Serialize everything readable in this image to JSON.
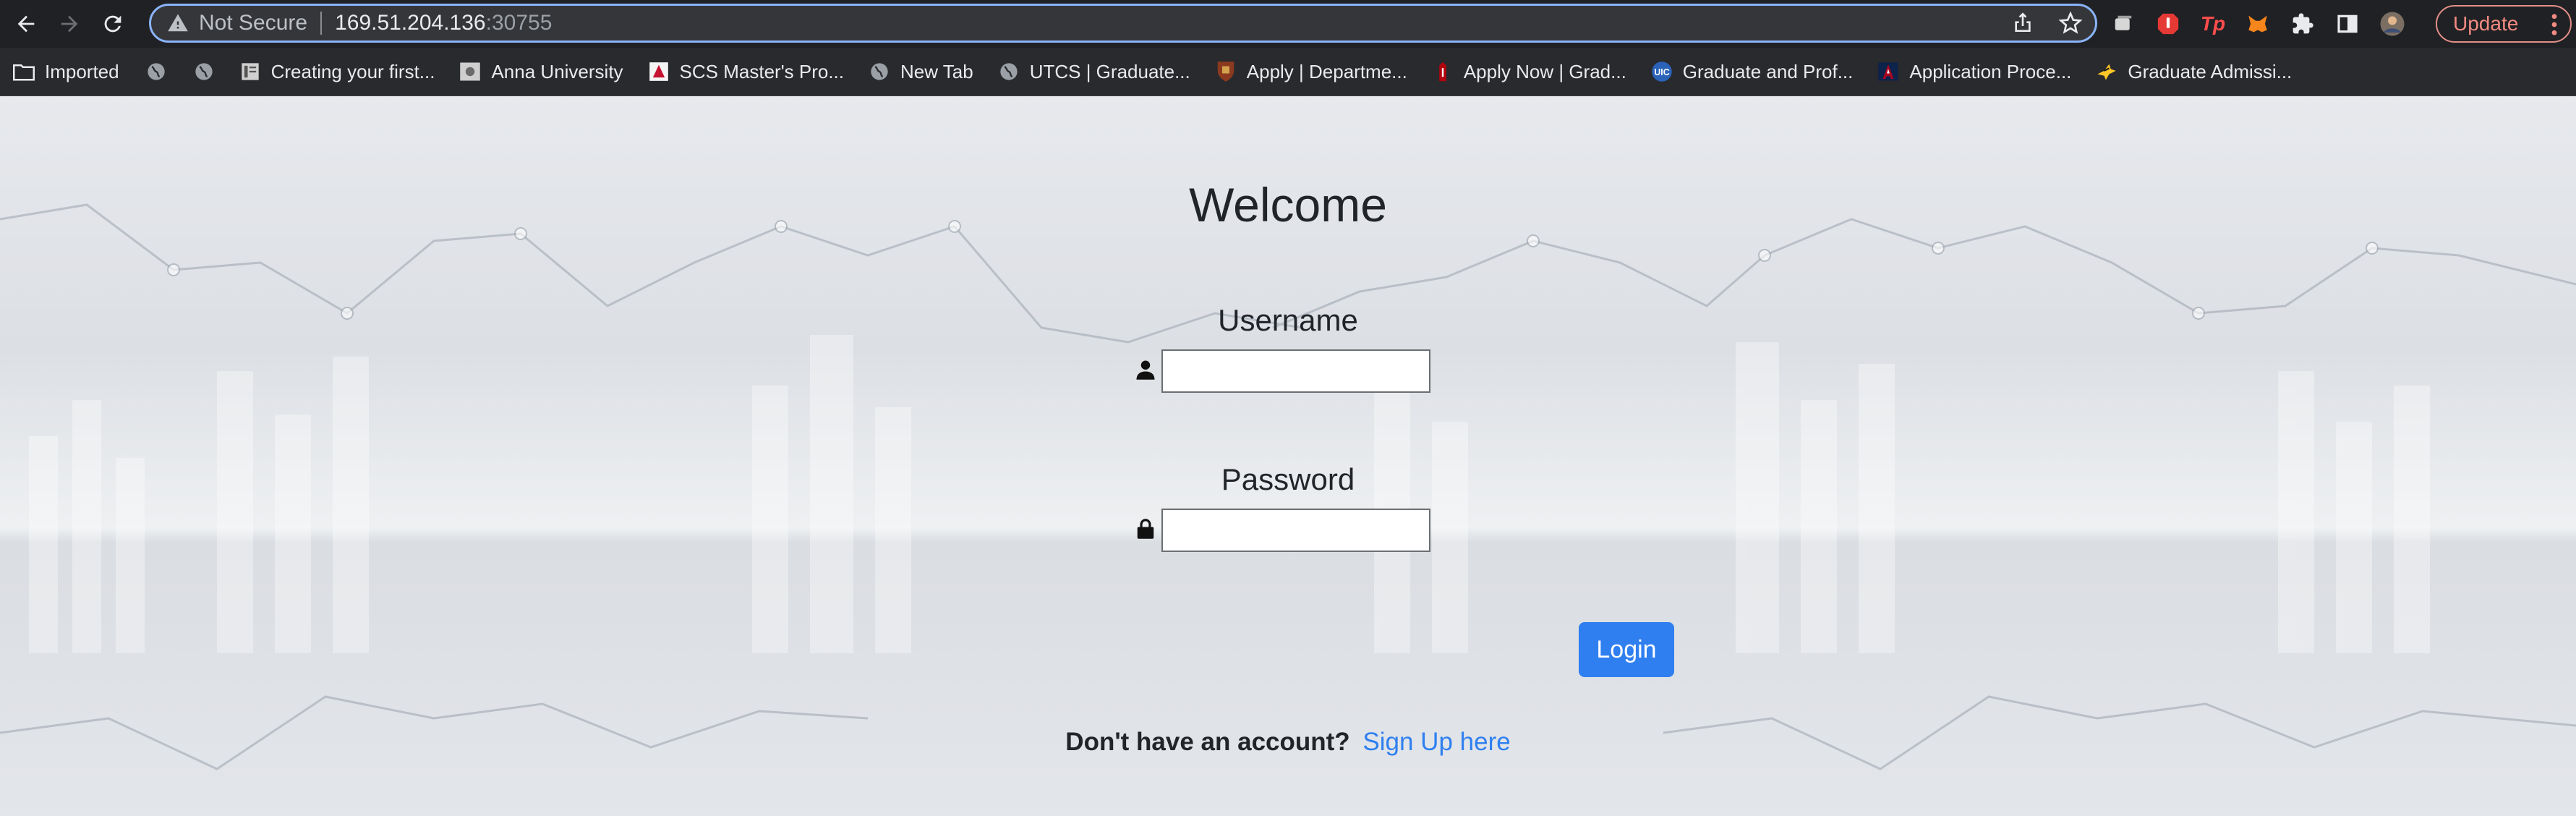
{
  "browser": {
    "address": {
      "security_label": "Not Secure",
      "host": "169.51.204.136",
      "port": ":30755"
    },
    "update_label": "Update",
    "bookmarks": [
      {
        "label": "Imported",
        "icon": "folder-icon"
      },
      {
        "label": "",
        "icon": "globe-icon"
      },
      {
        "label": "",
        "icon": "globe-icon"
      },
      {
        "label": "Creating your first...",
        "icon": "doc-icon"
      },
      {
        "label": "Anna University",
        "icon": "site-icon"
      },
      {
        "label": "SCS Master's Pro...",
        "icon": "cmu-icon"
      },
      {
        "label": "New Tab",
        "icon": "globe-icon"
      },
      {
        "label": "UTCS | Graduate...",
        "icon": "globe-icon"
      },
      {
        "label": "Apply | Departme...",
        "icon": "crest-icon"
      },
      {
        "label": "Apply Now | Grad...",
        "icon": "stanford-icon"
      },
      {
        "label": "Graduate and Prof...",
        "icon": "uic-icon"
      },
      {
        "label": "Application Proce...",
        "icon": "arizona-icon"
      },
      {
        "label": "Graduate Admissi...",
        "icon": "eagle-icon"
      }
    ]
  },
  "page": {
    "title": "Welcome",
    "username_label": "Username",
    "username_value": "",
    "password_label": "Password",
    "password_value": "",
    "login_label": "Login",
    "signup_prompt": "Don't have an account?",
    "signup_link": "Sign Up here"
  },
  "colors": {
    "primary": "#2f7ff0",
    "text": "#212529",
    "chrome_bg": "#202124"
  }
}
